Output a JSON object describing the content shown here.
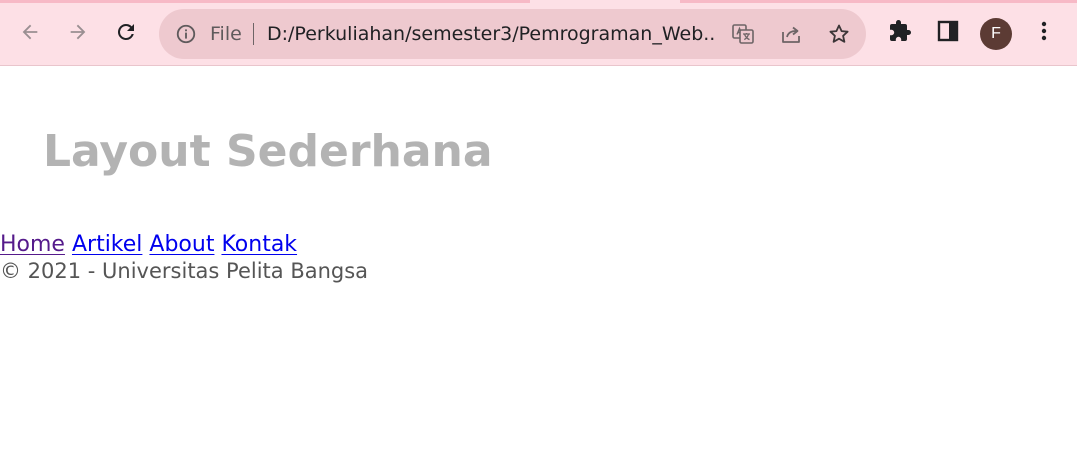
{
  "browser": {
    "scheme_label": "File",
    "url": "D:/Perkuliahan/semester3/Pemrograman_Web...",
    "profile_initial": "F",
    "icons": {
      "back": "back-arrow-icon",
      "forward": "forward-arrow-icon",
      "reload": "reload-icon",
      "info": "info-icon",
      "translate": "translate-icon",
      "share": "share-icon",
      "bookmark": "star-icon",
      "extensions": "puzzle-icon",
      "side_panel": "side-panel-icon",
      "menu": "kebab-menu-icon"
    },
    "colors": {
      "toolbar_bg": "#fde0e6",
      "omnibox_bg": "#eec9cf",
      "avatar_bg": "#5c3b34"
    }
  },
  "page": {
    "title": "Layout Sederhana",
    "nav": [
      {
        "label": "Home"
      },
      {
        "label": "Artikel"
      },
      {
        "label": "About"
      },
      {
        "label": "Kontak"
      }
    ],
    "footer": "© 2021 - Universitas Pelita Bangsa",
    "colors": {
      "title": "#b3b3b3",
      "link": "#0000ee",
      "visited_link": "#551a8b",
      "footer_text": "#555555"
    }
  }
}
